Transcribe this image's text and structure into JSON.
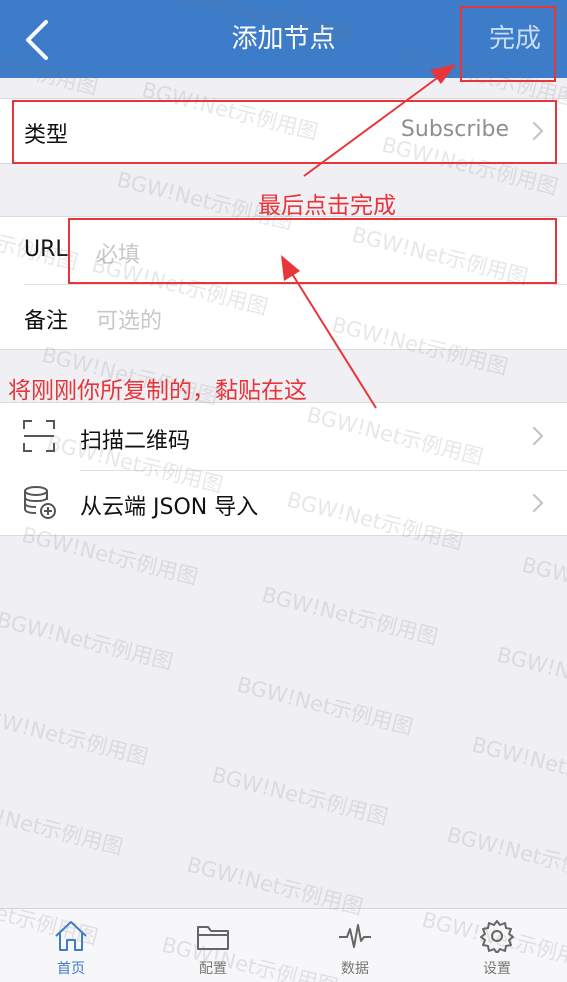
{
  "navbar": {
    "title": "添加节点",
    "done_label": "完成"
  },
  "type_row": {
    "label": "类型",
    "value": "Subscribe"
  },
  "url_row": {
    "label": "URL",
    "placeholder": "必填"
  },
  "note_row": {
    "label": "备注",
    "placeholder": "可选的"
  },
  "actions": [
    {
      "label": "扫描二维码",
      "icon": "scan-icon"
    },
    {
      "label": "从云端 JSON 导入",
      "icon": "database-import-icon"
    }
  ],
  "annotations": {
    "finish": "最后点击完成",
    "paste": "将刚刚你所复制的，黏贴在这"
  },
  "tabbar": {
    "items": [
      {
        "label": "首页",
        "icon": "home-icon",
        "active": true
      },
      {
        "label": "配置",
        "icon": "folder-icon",
        "active": false
      },
      {
        "label": "数据",
        "icon": "activity-icon",
        "active": false
      },
      {
        "label": "设置",
        "icon": "gear-icon",
        "active": false
      }
    ]
  },
  "watermark_text": "BGW!Net示例用图",
  "colors": {
    "navbar": "#3d7cc9",
    "annotation_red": "#e8353a",
    "active_tab": "#3d7cc9"
  }
}
